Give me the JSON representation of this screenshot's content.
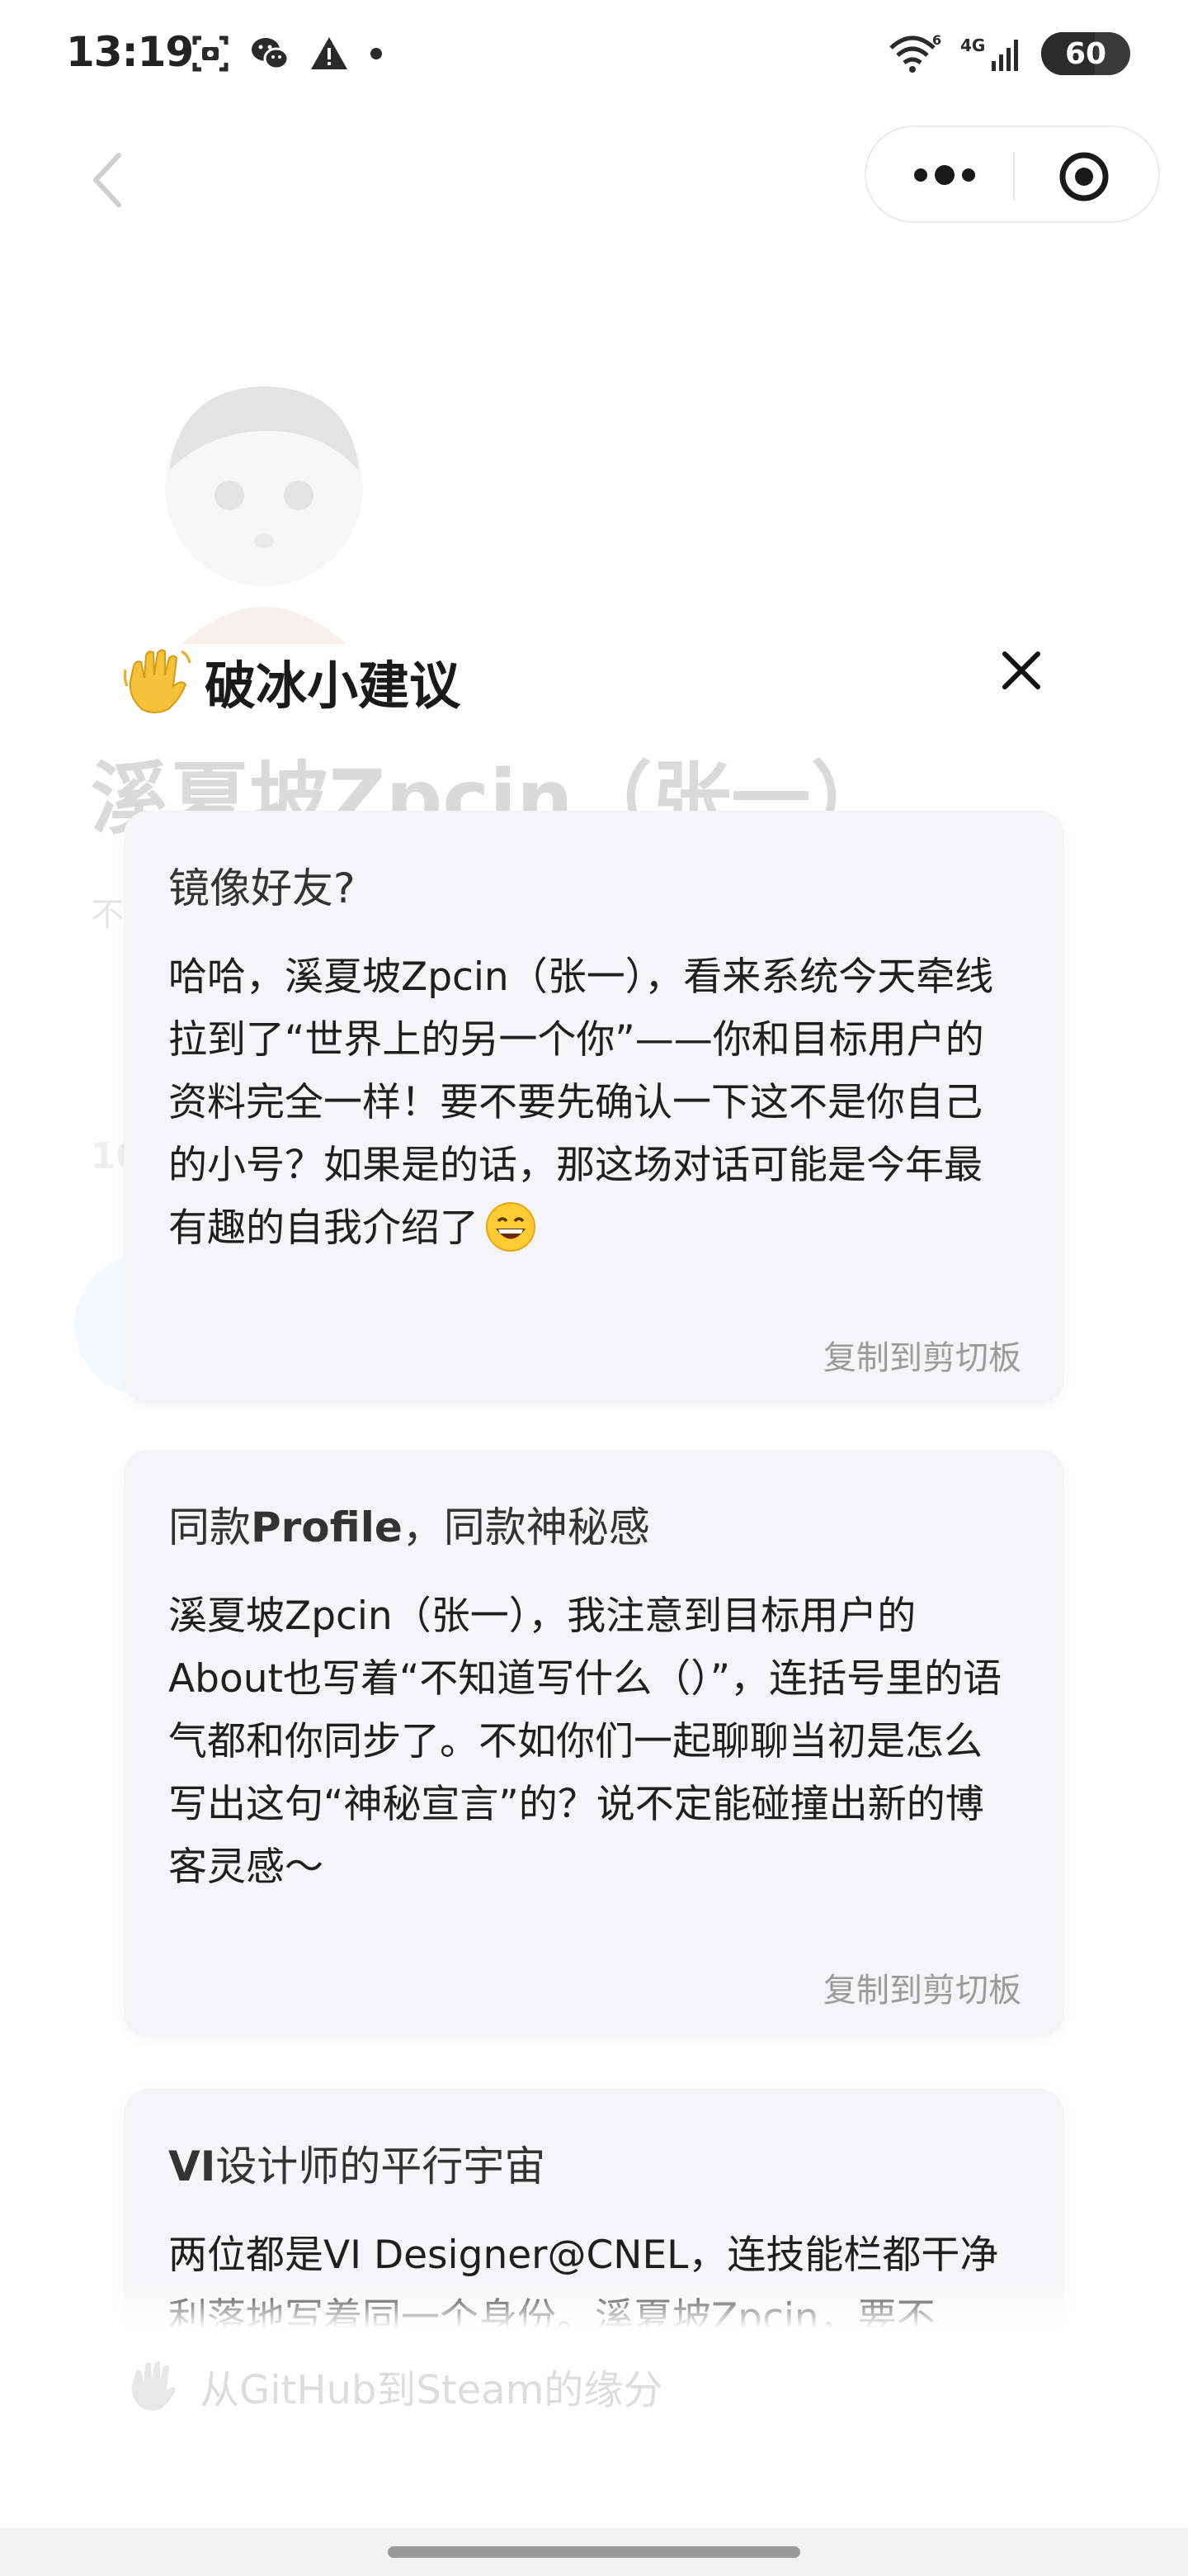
{
  "status_bar": {
    "time": "13:19",
    "signal": "4G",
    "wifi_badge": "6",
    "battery_level": "60",
    "battery_fraction": 0.6,
    "icons_left": [
      "screenshot-icon",
      "wechat-icon",
      "warning-icon",
      "dot-icon"
    ],
    "icons_right": [
      "wifi-icon",
      "cellular-icon",
      "battery-icon"
    ]
  },
  "background_profile": {
    "name": "溪夏坡Zpcin（张一）",
    "subtitle": "不",
    "number": "10",
    "footer_text": "从GitHub到Steam的缘分"
  },
  "popup": {
    "title": "破冰小建议",
    "title_icon": "waving-hand-icon",
    "close_icon": "close-icon"
  },
  "cards": [
    {
      "title": "镜像好友?",
      "body": "哈哈，溪夏坡Zpcin（张一），看来系统今天牵线拉到了“世界上的另一个你”——你和目标用户的资料完全一样！要不要先确认一下这不是你自己的小号？如果是的话，那这场对话可能是今年最有趣的自我介绍了",
      "body_emoji": "grinning-face-icon",
      "copy_label": "复制到剪切板"
    },
    {
      "title_bold": "Profile",
      "title_pre": "同款",
      "title_post": "，同款神秘感",
      "body": "溪夏坡Zpcin（张一），我注意到目标用户的About也写着“不知道写什么（）”，连括号里的语气都和你同步了。不如你们一起聊聊当初是怎么写出这句“神秘宣言”的？说不定能碰撞出新的博客灵感～",
      "copy_label": "复制到剪切板"
    },
    {
      "title_bold": "VI",
      "title_post": "设计师的平行宇宙",
      "body": "两位都是VI Designer@CNEL，连技能栏都干净利落地写着同一个身份。溪夏坡Zpcin，要不"
    }
  ],
  "colors": {
    "card_bg": "#f5f5f7",
    "copy_text": "#9b9b9b",
    "title_text": "#1a1a1a"
  }
}
